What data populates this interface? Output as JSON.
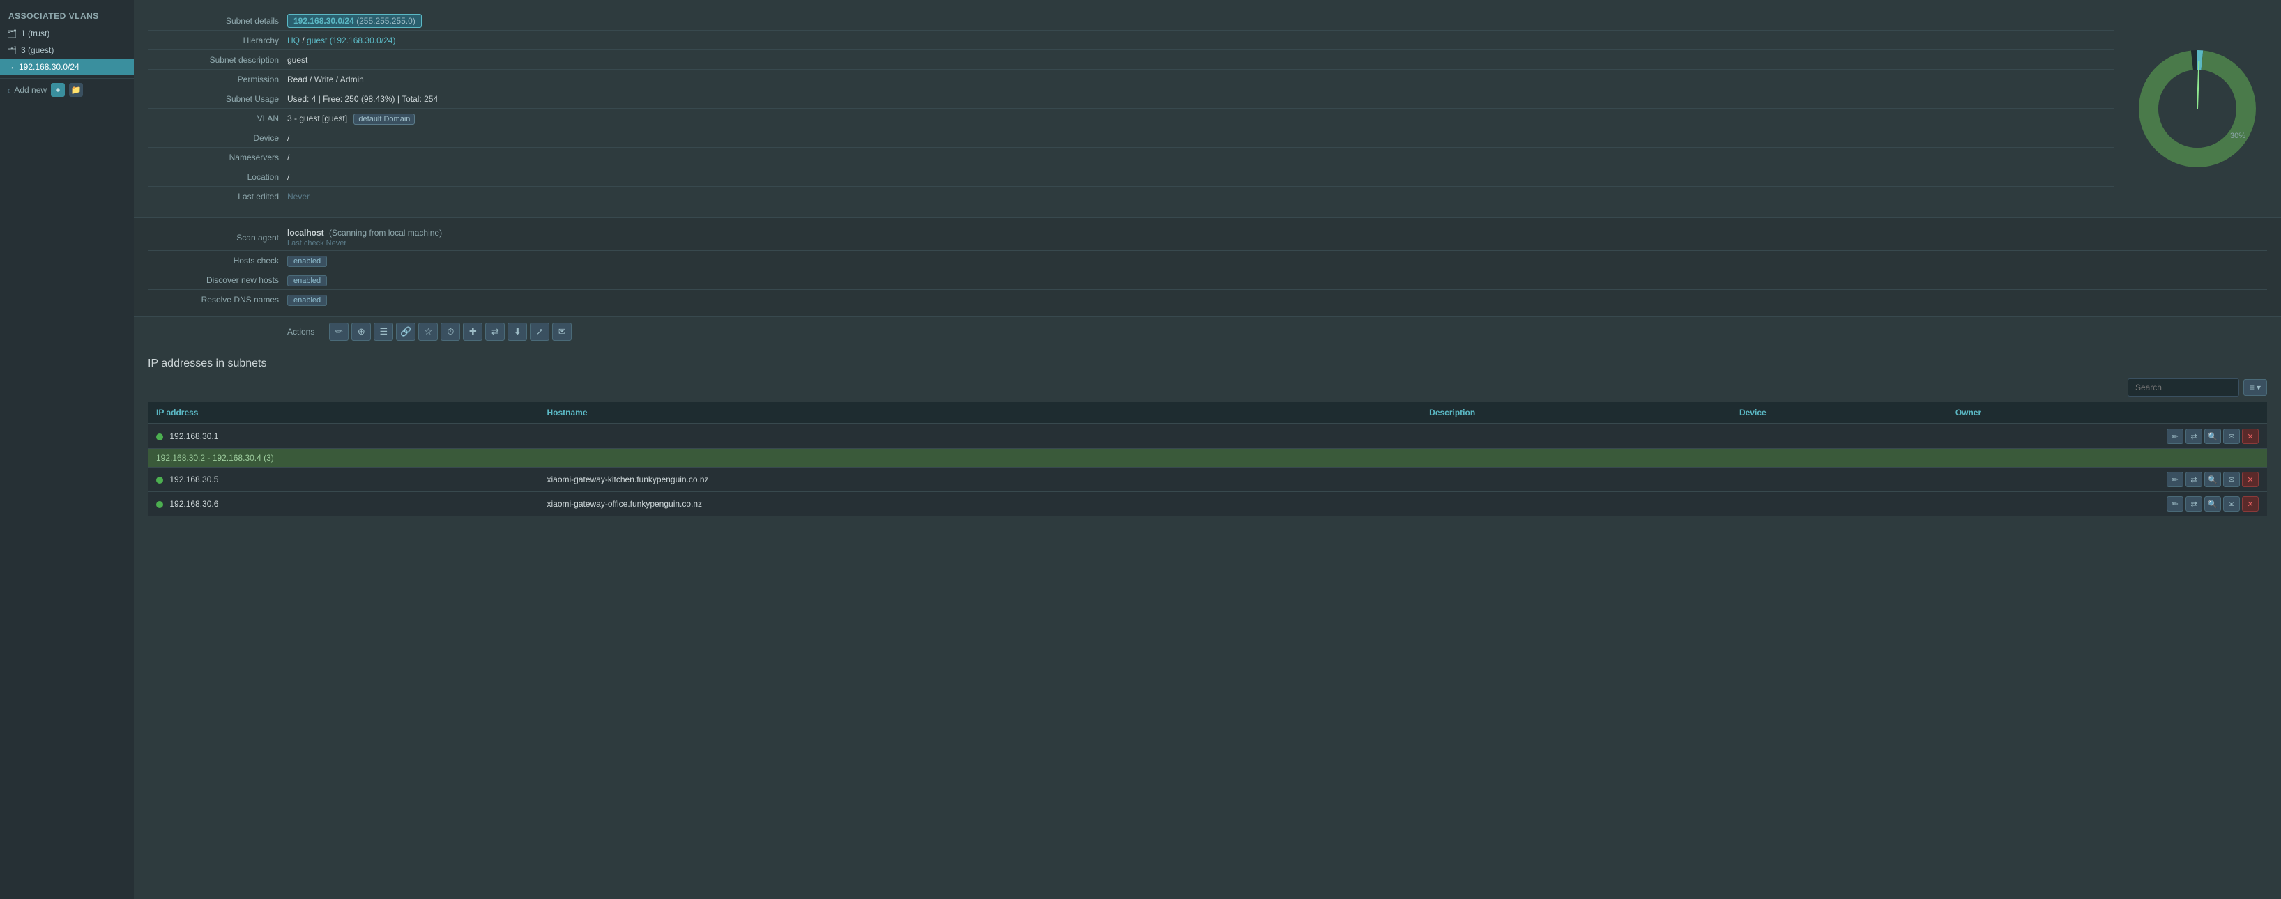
{
  "sidebar": {
    "title": "Associated VLANs",
    "items": [
      {
        "id": "trust",
        "label": "1 (trust)",
        "icon": "🗂",
        "active": false
      },
      {
        "id": "guest",
        "label": "3 (guest)",
        "icon": "🗂",
        "active": false
      },
      {
        "id": "subnet",
        "label": "192.168.30.0/24",
        "icon": "→",
        "active": true
      }
    ],
    "footer": {
      "add_label": "Add new",
      "plus_icon": "+",
      "folder_icon": "📁"
    }
  },
  "detail": {
    "subnet_details_label": "Subnet details",
    "subnet_value": "192.168.30.0/24",
    "subnet_mask": "(255.255.255.0)",
    "hierarchy_label": "Hierarchy",
    "hierarchy_value": "HQ / guest (192.168.30.0/24)",
    "hierarchy_hq": "HQ",
    "hierarchy_sep": " / ",
    "hierarchy_guest": "guest (192.168.30.0/24)",
    "subnet_desc_label": "Subnet description",
    "subnet_desc_value": "guest",
    "permission_label": "Permission",
    "permission_value": "Read / Write / Admin",
    "subnet_usage_label": "Subnet Usage",
    "subnet_usage_value": "Used: 4 | Free: 250 (98.43%) | Total: 254",
    "vlan_label": "VLAN",
    "vlan_value": "3 - guest [guest]",
    "vlan_tag": "default Domain",
    "device_label": "Device",
    "device_value": "/",
    "nameservers_label": "Nameservers",
    "nameservers_value": "/",
    "location_label": "Location",
    "location_value": "/",
    "last_edited_label": "Last edited",
    "last_edited_value": "Never"
  },
  "chart": {
    "used_percent": 1.57,
    "free_percent": 98.43,
    "label_30": "30%"
  },
  "scan": {
    "scan_agent_label": "Scan agent",
    "scan_agent_value": "localhost",
    "scan_agent_desc": "(Scanning from local machine)",
    "last_check_label": "Last check",
    "last_check_value": "Never",
    "hosts_check_label": "Hosts check",
    "hosts_check_value": "enabled",
    "discover_label": "Discover new hosts",
    "discover_value": "enabled",
    "resolve_label": "Resolve DNS names",
    "resolve_value": "enabled"
  },
  "actions": {
    "label": "Actions",
    "buttons": [
      {
        "id": "edit",
        "icon": "✏",
        "title": "Edit"
      },
      {
        "id": "add",
        "icon": "+",
        "title": "Add"
      },
      {
        "id": "list",
        "icon": "☰",
        "title": "List"
      },
      {
        "id": "link",
        "icon": "🔗",
        "title": "Link"
      },
      {
        "id": "star",
        "icon": "☆",
        "title": "Favorite"
      },
      {
        "id": "clock",
        "icon": "⏱",
        "title": "Schedule"
      },
      {
        "id": "plus2",
        "icon": "⊕",
        "title": "Add host"
      },
      {
        "id": "share",
        "icon": "⇄",
        "title": "Share"
      },
      {
        "id": "download",
        "icon": "⬇",
        "title": "Download"
      },
      {
        "id": "export",
        "icon": "↗",
        "title": "Export"
      },
      {
        "id": "email",
        "icon": "✉",
        "title": "Email"
      }
    ]
  },
  "ip_section": {
    "title": "IP addresses in subnets",
    "search_placeholder": "Search",
    "view_icon": "≡",
    "columns": [
      {
        "key": "ip",
        "label": "IP address"
      },
      {
        "key": "hostname",
        "label": "Hostname"
      },
      {
        "key": "description",
        "label": "Description"
      },
      {
        "key": "device",
        "label": "Device"
      },
      {
        "key": "owner",
        "label": "Owner"
      }
    ],
    "rows": [
      {
        "type": "host",
        "ip": "192.168.30.1",
        "hostname": "",
        "description": "",
        "device": "",
        "owner": "",
        "status": "online"
      },
      {
        "type": "range",
        "label": "192.168.30.2 - 192.168.30.4 (3)",
        "colspan": true
      },
      {
        "type": "host",
        "ip": "192.168.30.5",
        "hostname": "xiaomi-gateway-kitchen.funkypenguin.co.nz",
        "description": "",
        "device": "",
        "owner": "",
        "status": "online"
      },
      {
        "type": "host",
        "ip": "192.168.30.6",
        "hostname": "xiaomi-gateway-office.funkypenguin.co.nz",
        "description": "",
        "device": "",
        "owner": "",
        "status": "online"
      }
    ]
  }
}
